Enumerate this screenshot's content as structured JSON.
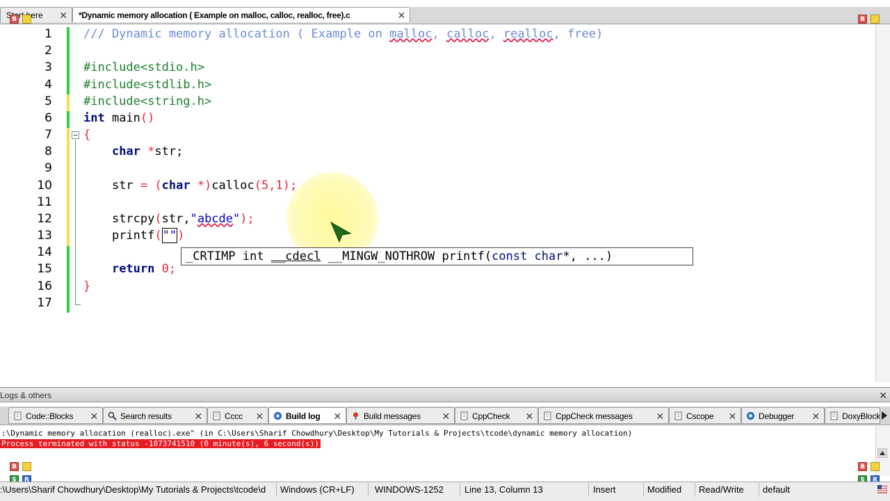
{
  "editor_tabs": [
    {
      "label": "Start here",
      "active": false
    },
    {
      "label": "*Dynamic memory allocation ( Example on malloc, calloc, realloc, free).c",
      "active": true
    }
  ],
  "tab_close_glyph": "✕",
  "corner_badges": {
    "b": "B",
    "s": "S",
    "r": "R"
  },
  "line_numbers": [
    "1",
    "2",
    "3",
    "4",
    "5",
    "6",
    "7",
    "8",
    "9",
    "10",
    "11",
    "12",
    "13",
    "14",
    "15",
    "16",
    "17"
  ],
  "code": {
    "l1": "/// Dynamic memory allocation ( Example on ",
    "l1_w1": "malloc",
    "l1_sep1": ", ",
    "l1_w2": "calloc",
    "l1_sep2": ", ",
    "l1_w3": "realloc",
    "l1_tail": ", free)",
    "l3": "#include<stdio.h>",
    "l4": "#include<stdlib.h>",
    "l5": "#include<string.h>",
    "l6_kw": "int",
    "l6_rest": " main",
    "l6_paren": "()",
    "l7": "{",
    "l8_kw": "char",
    "l8_op": " *",
    "l8_rest": "str;",
    "l10_a": "str ",
    "l10_eq": "= (",
    "l10_kw": "char",
    "l10_b": " *)",
    "l10_c": "calloc",
    "l10_p1": "(",
    "l10_n1": "5",
    "l10_comma": ",",
    "l10_n2": "1",
    "l10_end": ");",
    "l12_a": "strcpy",
    "l12_p": "(",
    "l12_b": "str,",
    "l12_s1": "\"",
    "l12_w": "abcde",
    "l12_s2": "\"",
    "l12_end": ");",
    "l13_a": "printf",
    "l13_p": "(",
    "l13_s": "\"\"",
    "l13_end": ")",
    "l15_kw": "return",
    "l15_n": " 0",
    "l15_end": ";",
    "l16": "}"
  },
  "calltip": {
    "a": "_CRTIMP int ",
    "b": "__cdecl",
    "c": " __MINGW_NOTHROW printf(",
    "kw": "const char",
    "d": "*, ...)"
  },
  "panel_title": "Logs & others",
  "panel_tabs": [
    {
      "label": "Code::Blocks",
      "icon": "document-icon"
    },
    {
      "label": "Search results",
      "icon": "magnifier-icon"
    },
    {
      "label": "Cccc",
      "icon": "document-icon"
    },
    {
      "label": "Build log",
      "icon": "gear-icon",
      "active": true
    },
    {
      "label": "Build messages",
      "icon": "pin-icon"
    },
    {
      "label": "CppCheck",
      "icon": "document-icon"
    },
    {
      "label": "CppCheck messages",
      "icon": "document-icon"
    },
    {
      "label": "Cscope",
      "icon": "document-icon"
    },
    {
      "label": "Debugger",
      "icon": "gear-icon"
    },
    {
      "label": "DoxyBlocks",
      "icon": "document-icon"
    }
  ],
  "build_log": {
    "line1": ":\\Dynamic memory allocation (realloc).exe\" (in C:\\Users\\Sharif Chowdhury\\Desktop\\My Tutorials & Projects\\tcode\\dynamic memory allocation)",
    "line2": "Process terminated with status -1073741510 (0 minute(s), 6 second(s))"
  },
  "status_bar": {
    "path": ":\\Users\\Sharif Chowdhury\\Desktop\\My Tutorials & Projects\\tcode\\d",
    "eol": "Windows (CR+LF)",
    "encoding": "WINDOWS-1252",
    "position": "Line 13, Column 13",
    "mode": "Insert",
    "modified": "Modified",
    "access": "Read/Write",
    "lang": "default"
  },
  "colors": {
    "comment": "#6a8ad8",
    "preprocessor": "#1c7f2e",
    "keyword": "#000c7a",
    "string": "#0000cc",
    "number": "#e8283d",
    "error_bg": "#e51c23"
  }
}
